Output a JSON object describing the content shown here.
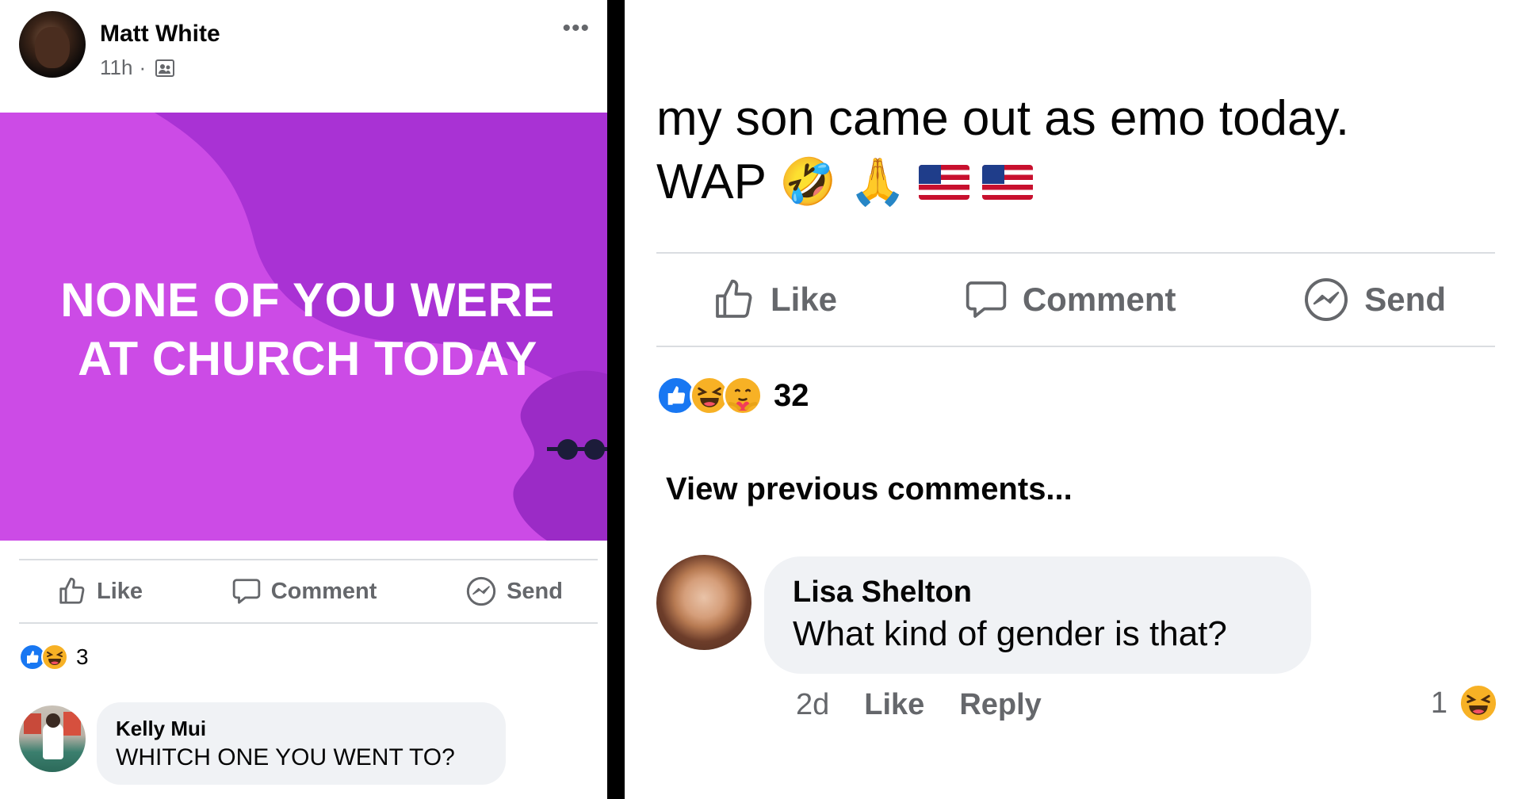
{
  "left_post": {
    "author": "Matt White",
    "time": "11h",
    "separator": "·",
    "privacy_icon": "friends-icon",
    "more_label": "•••",
    "banner_text_line1": "NONE OF YOU WERE",
    "banner_text_line2": "AT CHURCH TODAY",
    "banner_color": "#a932d4",
    "actions": {
      "like": "Like",
      "comment": "Comment",
      "send": "Send"
    },
    "reaction_count": "3",
    "comment": {
      "author": "Kelly Mui",
      "text": "WHITCH ONE YOU WENT TO?"
    }
  },
  "right_post": {
    "text_line1": "my son came out as emo today.",
    "text_line2": "WAP",
    "emojis": [
      "🤣",
      "🙏"
    ],
    "flags": [
      "us-flag",
      "us-flag"
    ],
    "actions": {
      "like": "Like",
      "comment": "Comment",
      "send": "Send"
    },
    "reaction_count": "32",
    "view_previous": "View previous comments...",
    "comment": {
      "author": "Lisa Shelton",
      "text": "What kind of gender is that?",
      "time": "2d",
      "like": "Like",
      "reply": "Reply",
      "reaction_count": "1"
    }
  },
  "colors": {
    "facebook_blue": "#1877f2",
    "secondary_text": "#65676b",
    "bubble_bg": "#f0f2f5",
    "haha_yellow": "#f7b125"
  }
}
